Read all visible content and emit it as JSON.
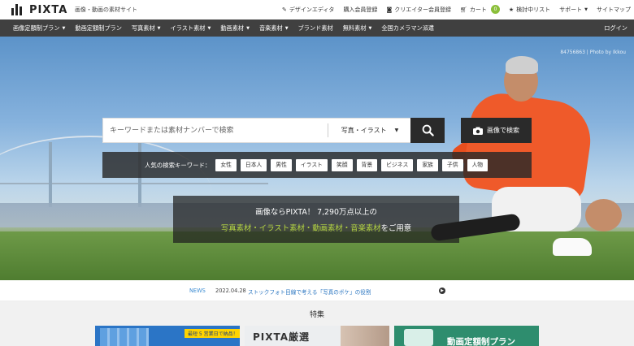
{
  "header": {
    "logo_text": "PIXTA",
    "tagline": "画像・動画の素材サイト",
    "links": [
      {
        "icon": "pencil-icon",
        "label": "デザインエディタ"
      },
      {
        "icon": "",
        "label": "購入会員登録"
      },
      {
        "icon": "camera-icon",
        "label": "クリエイター会員登録"
      },
      {
        "icon": "cart-icon",
        "label": "カート",
        "count": "0"
      },
      {
        "icon": "star-icon",
        "label": "検討中リスト"
      },
      {
        "icon": "",
        "label": "サポート",
        "dropdown": true
      },
      {
        "icon": "",
        "label": "サイトマップ"
      }
    ]
  },
  "nav": {
    "items": [
      {
        "label": "画像定額制プラン",
        "dropdown": true
      },
      {
        "label": "動画定額制プラン",
        "dropdown": false
      },
      {
        "label": "写真素材",
        "dropdown": true
      },
      {
        "label": "イラスト素材",
        "dropdown": true
      },
      {
        "label": "動画素材",
        "dropdown": true
      },
      {
        "label": "音楽素材",
        "dropdown": true
      },
      {
        "label": "ブランド素材",
        "dropdown": false
      },
      {
        "label": "無料素材",
        "dropdown": true
      },
      {
        "label": "全国カメラマン派遣",
        "dropdown": false
      }
    ],
    "login": "ログイン"
  },
  "hero": {
    "watermark": "84756863 | Photo by Ikkou",
    "search": {
      "placeholder": "キーワードまたは素材ナンバーで検索",
      "category": "写真・イラスト",
      "image_search_label": "画像で検索"
    },
    "keywords": {
      "label": "人気の検索キーワード：",
      "tags": [
        "女性",
        "日本人",
        "男性",
        "イラスト",
        "笑顔",
        "背景",
        "ビジネス",
        "家族",
        "子供",
        "人物"
      ]
    },
    "promo": {
      "line1": "画像ならPIXTA！ 7,290万点以上の",
      "line2_accent": "写真素材・イラスト素材・動画素材・音楽素材",
      "line2_rest": "をご用意"
    }
  },
  "news": {
    "tag": "NEWS",
    "date": "2022.04.28",
    "text": "ストックフォト目線で考える「写真のボケ」の役割"
  },
  "featured": {
    "title": "特集",
    "cards": [
      {
        "badge": "最短 5 営業日で納品！"
      },
      {
        "title": "PIXTA厳選"
      },
      {
        "title": "動画定額制プラン"
      }
    ]
  },
  "colors": {
    "nav_bg": "#404040",
    "accent_green": "#b5d642",
    "link_blue": "#2e78c2"
  }
}
